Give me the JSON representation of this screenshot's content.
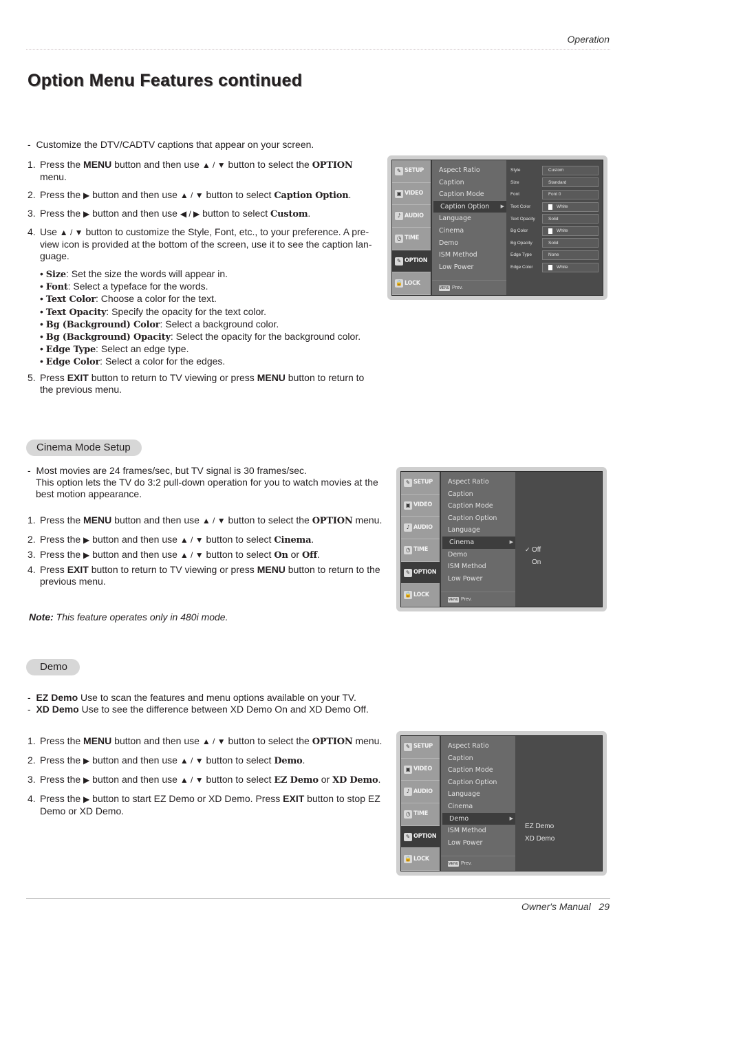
{
  "header": {
    "section_label": "Operation",
    "title": "Option Menu Features continued"
  },
  "caption_option": {
    "intro": "Customize the DTV/CADTV captions that appear on your screen.",
    "steps": [
      {
        "num": "1.",
        "parts": [
          "Press the ",
          "MENU",
          " button and then use ",
          "▲ / ▼",
          " button to select the ",
          "OPTION",
          " menu."
        ]
      },
      {
        "num": "2.",
        "parts": [
          "Press the ",
          "▶",
          " button and then use ",
          "▲ / ▼",
          " button to select ",
          "Caption Option",
          "."
        ]
      },
      {
        "num": "3.",
        "parts": [
          "Press the ",
          "▶",
          " button and then use ",
          "◀ / ▶",
          " button to select ",
          "Custom",
          "."
        ]
      },
      {
        "num": "4.",
        "parts": [
          "Use ",
          "▲ / ▼",
          " button to customize the Style, Font, etc., to your preference. A pre-view icon is provided at the bottom of the screen, use it to see the caption lan-guage."
        ]
      },
      {
        "num": "5.",
        "parts": [
          "Press ",
          "EXIT",
          " button to return to TV viewing or press ",
          "MENU",
          " button to return to the previous menu."
        ]
      }
    ],
    "bullets": [
      {
        "term": "Size",
        "desc": ": Set the size the words will appear in."
      },
      {
        "term": "Font",
        "desc": ": Select a typeface for the words."
      },
      {
        "term": "Text Color",
        "desc": ": Choose a color for the text."
      },
      {
        "term": "Text Opacity",
        "desc": ": Specify the opacity for the text color."
      },
      {
        "term": "Bg (Background) Color",
        "desc": ": Select a background color."
      },
      {
        "term": "Bg (Background) Opacity",
        "desc": ": Select the opacity for the background color."
      },
      {
        "term": "Edge Type",
        "desc": ": Select an edge type."
      },
      {
        "term": "Edge Color",
        "desc": ": Select a color for the edges."
      }
    ]
  },
  "osd": {
    "categories": [
      "SETUP",
      "VIDEO",
      "AUDIO",
      "TIME",
      "OPTION",
      "LOCK"
    ],
    "active_category": "OPTION",
    "menu_items": [
      "Aspect Ratio",
      "Caption",
      "Caption Mode",
      "Caption Option",
      "Language",
      "Cinema",
      "Demo",
      "ISM Method",
      "Low Power"
    ],
    "prev_label": "Prev.",
    "prev_key": "MENU",
    "caption_options": [
      {
        "label": "Style",
        "value": "Custom",
        "swatch": false
      },
      {
        "label": "Size",
        "value": "Standard",
        "swatch": false
      },
      {
        "label": "Font",
        "value": "Font 0",
        "swatch": false
      },
      {
        "label": "Text Color",
        "value": "White",
        "swatch": true
      },
      {
        "label": "Text Opacity",
        "value": "Solid",
        "swatch": false
      },
      {
        "label": "Bg Color",
        "value": "White",
        "swatch": true
      },
      {
        "label": "Bg Opacity",
        "value": "Solid",
        "swatch": false
      },
      {
        "label": "Edge Type",
        "value": "None",
        "swatch": false
      },
      {
        "label": "Edge Color",
        "value": "White",
        "swatch": true
      }
    ],
    "cinema_options": [
      {
        "label": "Off",
        "checked": true
      },
      {
        "label": "On",
        "checked": false
      }
    ],
    "demo_options": [
      {
        "label": "EZ Demo"
      },
      {
        "label": "XD Demo"
      }
    ]
  },
  "cinema": {
    "heading": "Cinema Mode Setup",
    "intro_lines": [
      "Most movies are 24 frames/sec, but TV signal is 30 frames/sec.",
      "This option lets the TV do 3:2 pull-down operation for you to watch movies at the best motion appearance."
    ],
    "steps": [
      {
        "num": "1.",
        "parts": [
          "Press the ",
          "MENU",
          " button and then use ",
          "▲ / ▼",
          " button to select the ",
          "OPTION",
          " menu."
        ]
      },
      {
        "num": "2.",
        "parts": [
          "Press the ",
          "▶",
          " button and then use ",
          "▲ / ▼",
          " button to select ",
          "Cinema",
          "."
        ]
      },
      {
        "num": "3.",
        "parts": [
          "Press the ",
          "▶",
          " button and then use ",
          "▲ / ▼",
          " button to select ",
          "On",
          " or ",
          "Off",
          "."
        ]
      },
      {
        "num": "4.",
        "parts": [
          "Press ",
          "EXIT",
          " button to return to TV viewing or press ",
          "MENU",
          " button to return to the previous menu."
        ]
      }
    ],
    "note_label": "Note:",
    "note_text": " This feature operates only in 480i mode."
  },
  "demo": {
    "heading": "Demo",
    "defs": [
      {
        "term": "EZ Demo",
        "desc": "  Use to scan the features and menu options available on your TV."
      },
      {
        "term": "XD Demo",
        "desc": "  Use to see the difference between XD Demo On and XD Demo Off."
      }
    ],
    "steps": [
      {
        "num": "1.",
        "parts": [
          "Press the ",
          "MENU",
          " button and then use ",
          "▲ / ▼",
          " button to select the ",
          "OPTION",
          " menu."
        ]
      },
      {
        "num": "2.",
        "parts": [
          "Press the ",
          "▶",
          " button and then use ",
          "▲ / ▼",
          " button to select ",
          "Demo",
          "."
        ]
      },
      {
        "num": "3.",
        "parts": [
          "Press the ",
          "▶",
          " button and then use ",
          "▲ / ▼",
          " button to select ",
          "EZ Demo",
          " or ",
          "XD Demo",
          "."
        ]
      },
      {
        "num": "4.",
        "parts": [
          "Press the ",
          "▶",
          " button to start EZ Demo or XD Demo. Press ",
          "EXIT",
          " button to stop EZ Demo or XD Demo."
        ]
      }
    ]
  },
  "footer": {
    "label": "Owner's Manual",
    "page": "29"
  }
}
